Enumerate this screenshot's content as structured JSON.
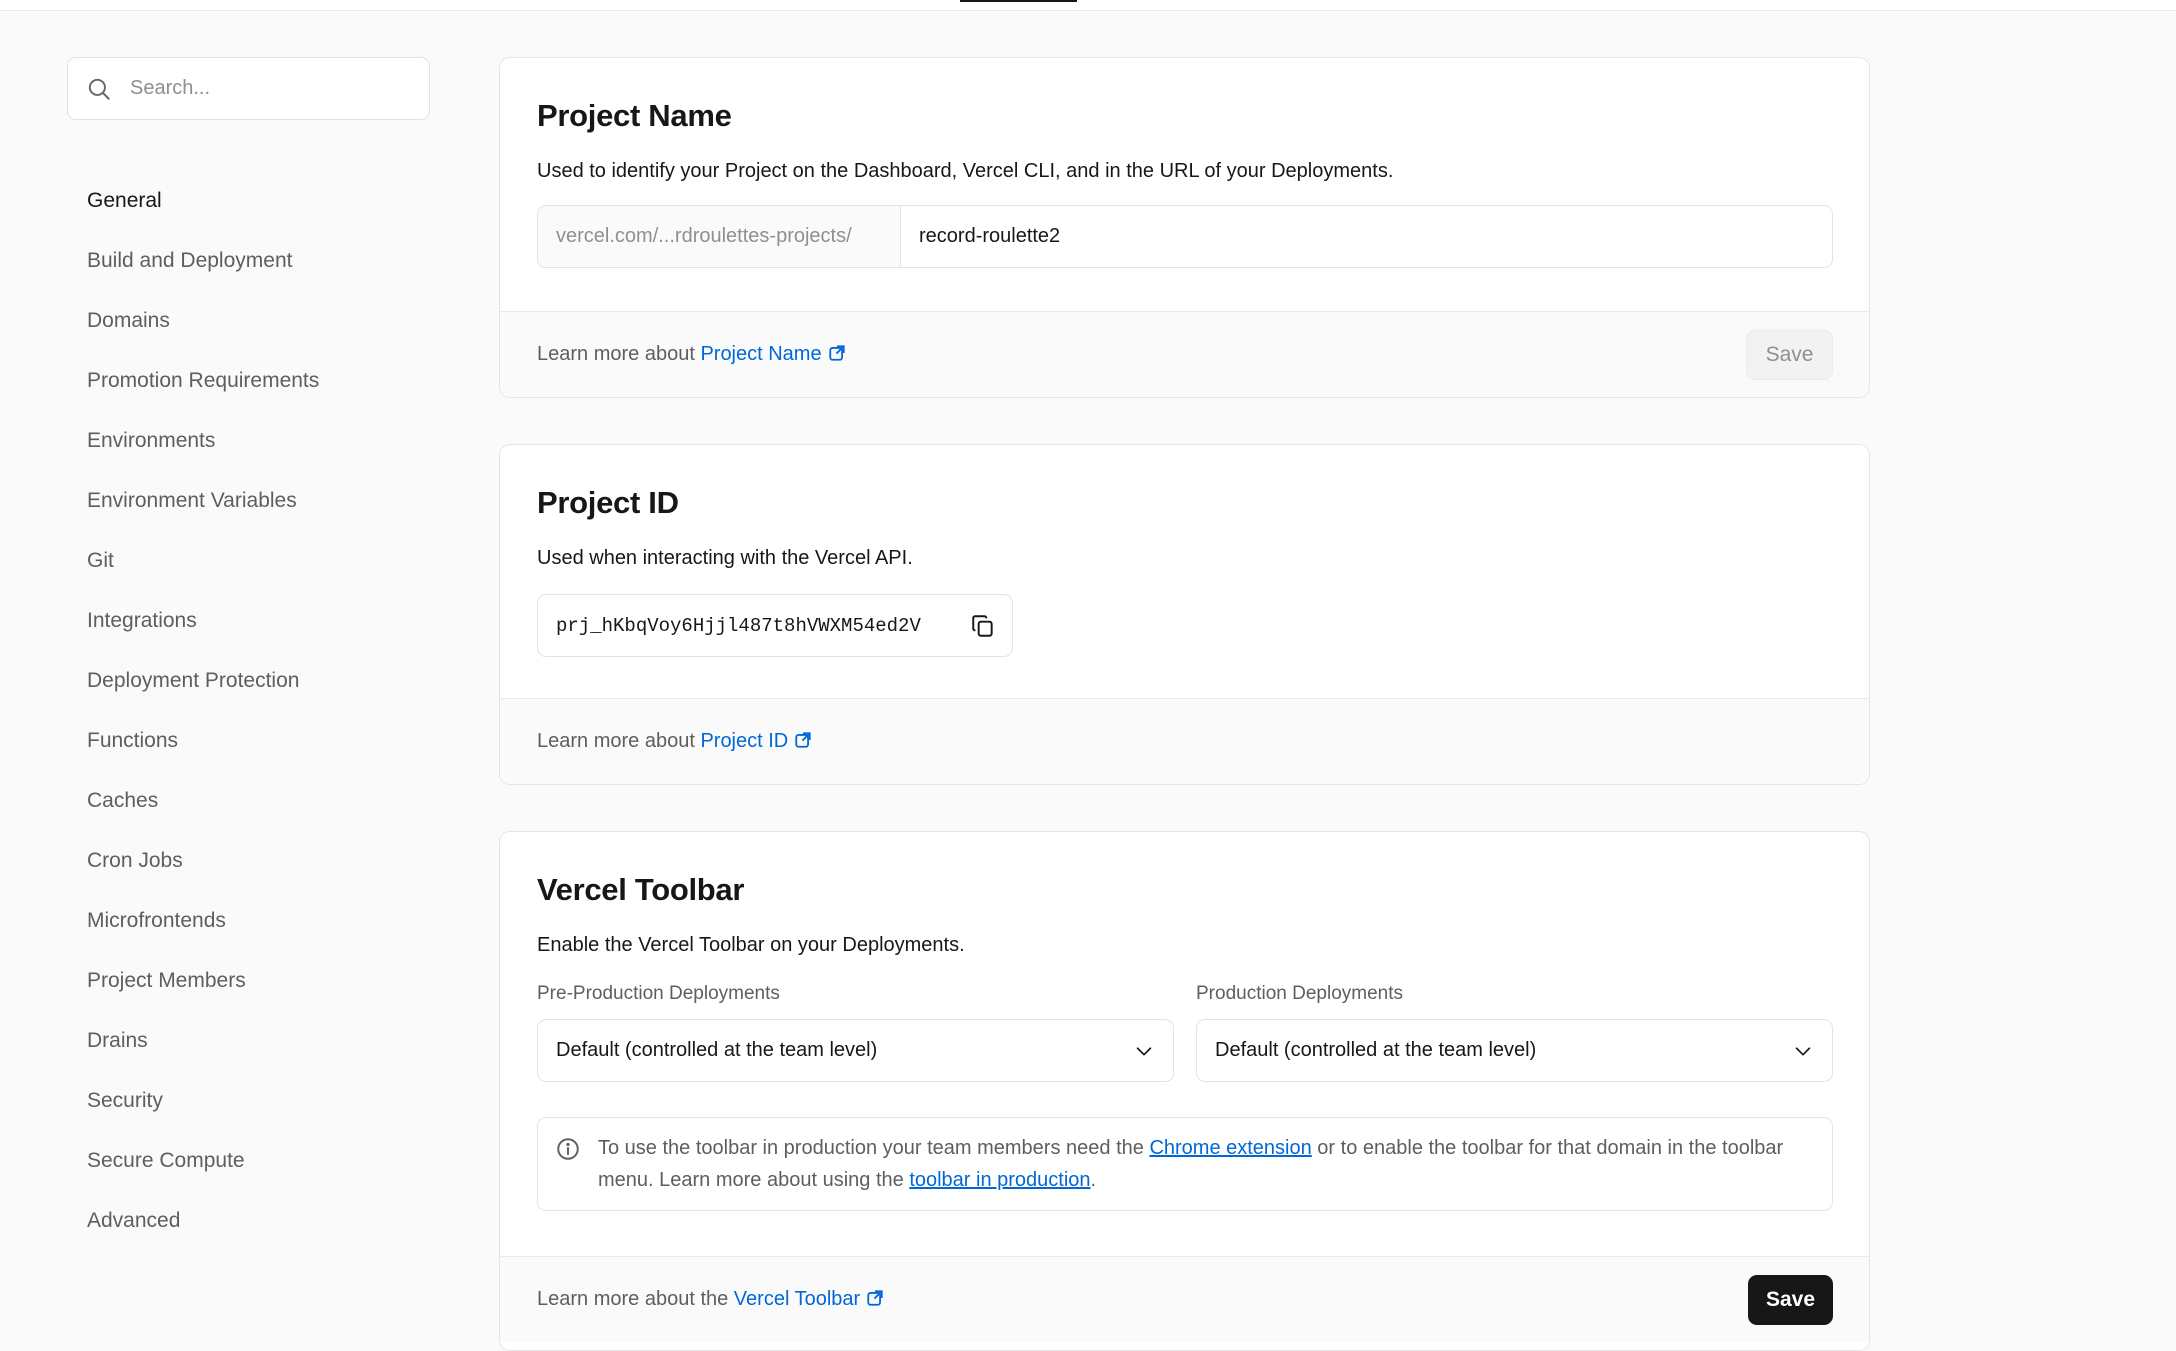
{
  "sidebar": {
    "search_placeholder": "Search...",
    "items": [
      {
        "label": "General"
      },
      {
        "label": "Build and Deployment"
      },
      {
        "label": "Domains"
      },
      {
        "label": "Promotion Requirements"
      },
      {
        "label": "Environments"
      },
      {
        "label": "Environment Variables"
      },
      {
        "label": "Git"
      },
      {
        "label": "Integrations"
      },
      {
        "label": "Deployment Protection"
      },
      {
        "label": "Functions"
      },
      {
        "label": "Caches"
      },
      {
        "label": "Cron Jobs"
      },
      {
        "label": "Microfrontends"
      },
      {
        "label": "Project Members"
      },
      {
        "label": "Drains"
      },
      {
        "label": "Security"
      },
      {
        "label": "Secure Compute"
      },
      {
        "label": "Advanced"
      }
    ],
    "active_item": "General"
  },
  "project_name": {
    "title": "Project Name",
    "description": "Used to identify your Project on the Dashboard, Vercel CLI, and in the URL of your Deployments.",
    "prefix": "vercel.com/...rdroulettes-projects/",
    "value": "record-roulette2",
    "footer_text": "Learn more about ",
    "footer_link": "Project Name",
    "save_label": "Save"
  },
  "project_id": {
    "title": "Project ID",
    "description": "Used when interacting with the Vercel API.",
    "value": "prj_hKbqVoy6Hjjl487t8hVWXM54ed2V",
    "footer_text": "Learn more about ",
    "footer_link": "Project ID"
  },
  "vercel_toolbar": {
    "title": "Vercel Toolbar",
    "description": "Enable the Vercel Toolbar on your Deployments.",
    "preprod_label": "Pre-Production Deployments",
    "preprod_value": "Default (controlled at the team level)",
    "prod_label": "Production Deployments",
    "prod_value": "Default (controlled at the team level)",
    "notice_text_1": "To use the toolbar in production your team members need the ",
    "notice_link_1": "Chrome extension",
    "notice_text_2": " or to enable the toolbar for that domain in the toolbar menu. Learn more about using the ",
    "notice_link_2": "toolbar in production",
    "notice_text_3": ".",
    "footer_text": "Learn more about the ",
    "footer_link": "Vercel Toolbar",
    "save_label": "Save"
  },
  "colors": {
    "link": "#0068d6",
    "primary_button": "#171717",
    "background": "#fafafa"
  }
}
